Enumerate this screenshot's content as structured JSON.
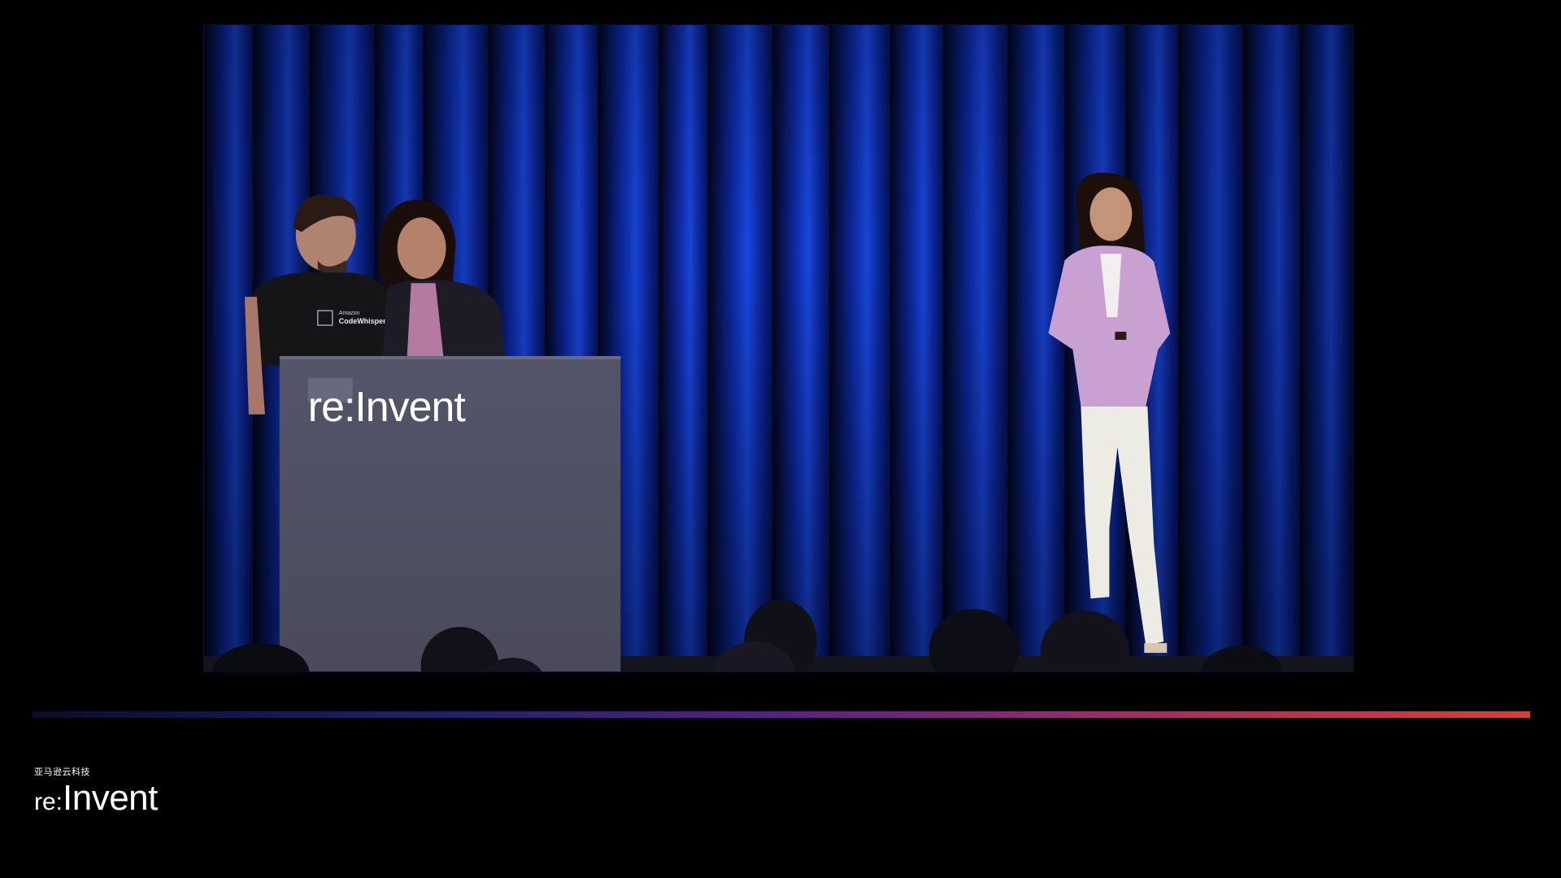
{
  "video": {
    "podium_logo": "re:Invent",
    "shirt_text_top": "Amazon",
    "shirt_text_main": "CodeWhisperer"
  },
  "brand": {
    "subtitle": "亚马逊云科技",
    "logo_re": "re:",
    "logo_invent": "Invent"
  },
  "colors": {
    "background": "#000000",
    "curtain": "#0a2fb0",
    "gradient_start": "#0b0c2a",
    "gradient_end": "#d8402e"
  }
}
